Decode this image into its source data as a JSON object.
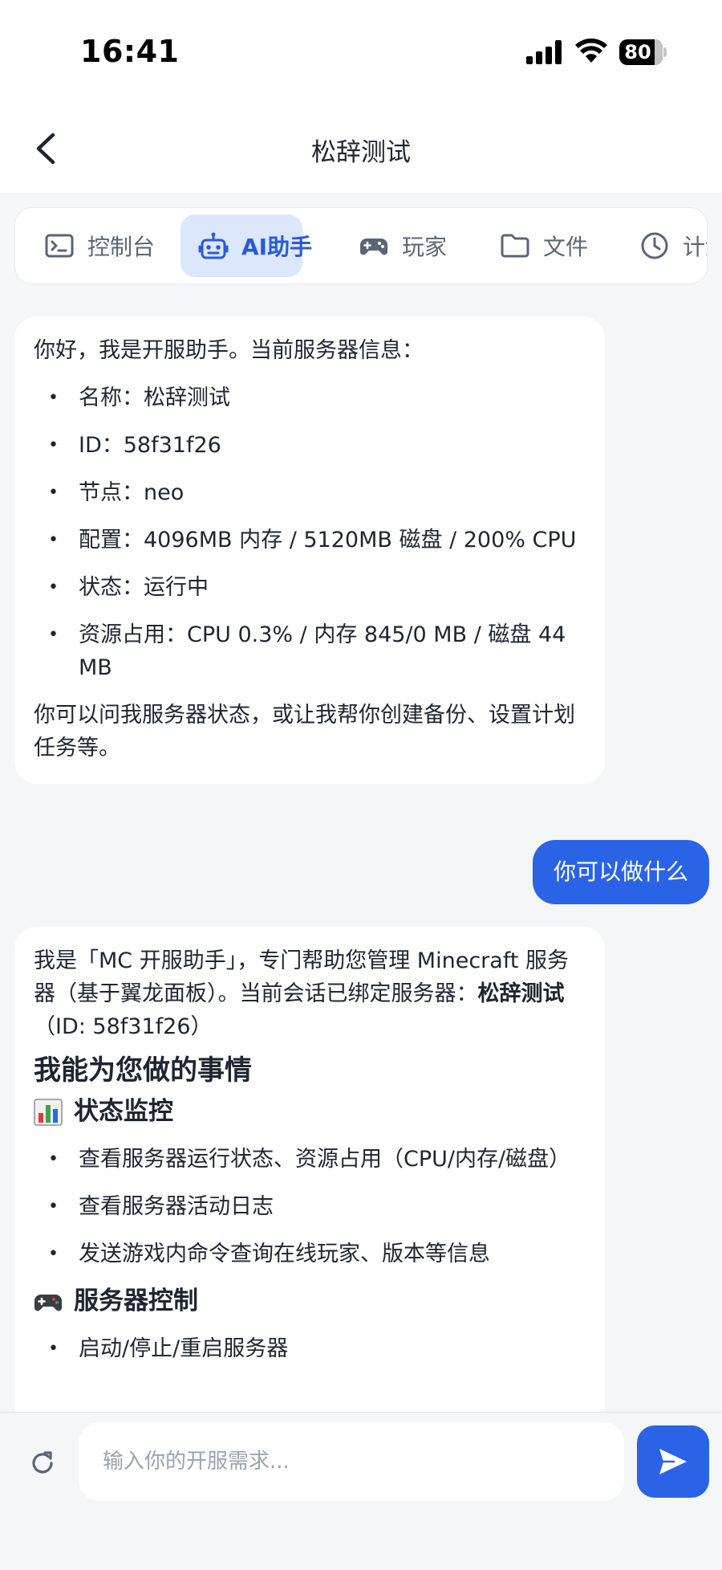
{
  "status_bar": {
    "time": "16:41",
    "battery": "80"
  },
  "nav": {
    "title": "松辞测试"
  },
  "tabs": [
    {
      "label": "控制台",
      "icon": "terminal-icon"
    },
    {
      "label": "AI助手",
      "icon": "robot-icon",
      "active": true
    },
    {
      "label": "玩家",
      "icon": "gamepad-icon"
    },
    {
      "label": "文件",
      "icon": "folder-icon"
    },
    {
      "label": "计划",
      "icon": "clock-icon"
    }
  ],
  "messages": {
    "ai_1": {
      "intro": "你好，我是开服助手。当前服务器信息：",
      "items": [
        "名称：松辞测试",
        "ID：58f31f26",
        "节点：neo",
        "配置：4096MB 内存 / 5120MB 磁盘 / 200% CPU",
        "状态：运行中",
        "资源占用：CPU 0.3% / 内存 845/0 MB / 磁盘 44 MB"
      ],
      "outro": "你可以问我服务器状态，或让我帮你创建备份、设置计划任务等。"
    },
    "user_1": "你可以做什么",
    "ai_2": {
      "intro_a": "我是「MC 开服助手」，专门帮助您管理 Minecraft 服务器（基于翼龙面板）。当前会话已绑定服务器：",
      "intro_bold": "松辞测试",
      "intro_b": "（ID: 58f31f26）",
      "heading": "我能为您做的事情",
      "section_1": {
        "title": "状态监控",
        "icon": "bar-chart-emoji",
        "items": [
          "查看服务器运行状态、资源占用（CPU/内存/磁盘）",
          "查看服务器活动日志",
          "发送游戏内命令查询在线玩家、版本等信息"
        ]
      },
      "section_2": {
        "title": "服务器控制",
        "icon": "gamepad-emoji",
        "items": [
          "启动/停止/重启服务器"
        ]
      }
    }
  },
  "composer": {
    "placeholder": "输入你的开服需求..."
  }
}
